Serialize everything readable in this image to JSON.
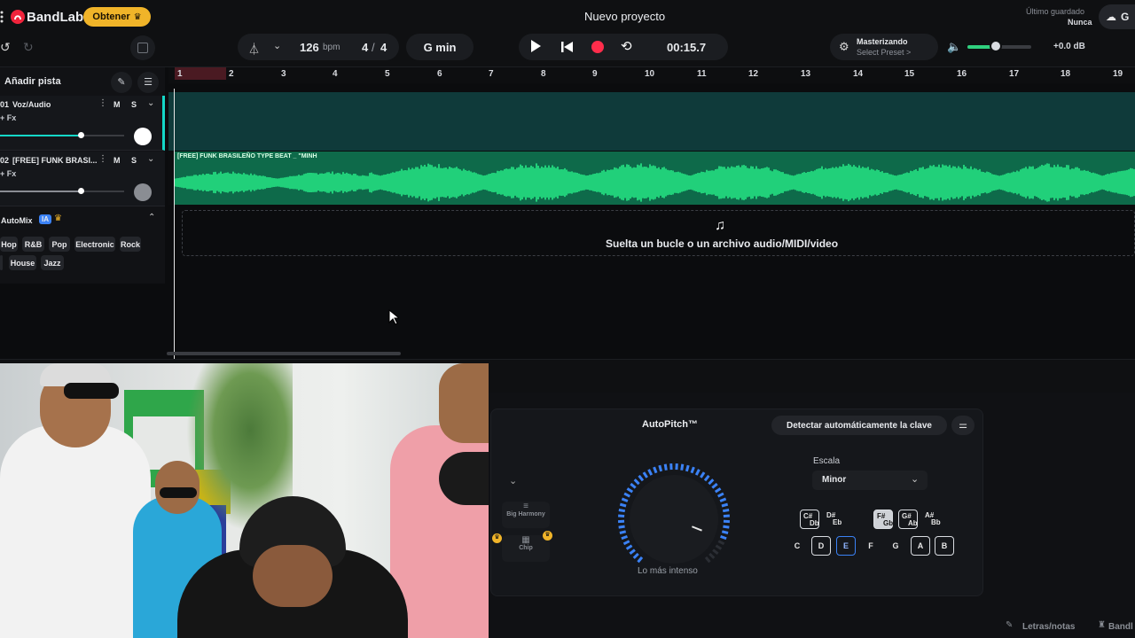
{
  "app": {
    "brand": "BandLab",
    "get_label": "Obtener",
    "project_title": "Nuevo proyecto",
    "last_saved_label": "Último guardado",
    "last_saved_value": "Nunca",
    "get_btn_partial": "G"
  },
  "transport": {
    "bpm_value": "126",
    "bpm_unit": "bpm",
    "time_sig_num": "4",
    "time_sig_sep": "/",
    "time_sig_den": "4",
    "key": "G min",
    "time": "00:15.7"
  },
  "mastering": {
    "title": "Masterizando",
    "preset": "Select Preset >"
  },
  "volume": {
    "db": "+0.0 dB",
    "level": 0.45
  },
  "left": {
    "add_track": "Añadir pista",
    "tracks": [
      {
        "num": "01",
        "name": "Voz/Audio",
        "fx": "+ Fx",
        "m": "M",
        "s": "S",
        "volume": 0.6
      },
      {
        "num": "02",
        "name": "[FREE] FUNK BRASI...",
        "fx": "+ Fx",
        "m": "M",
        "s": "S",
        "volume": 0.6
      }
    ],
    "automix": {
      "label": "AutoMix",
      "ia": "IA",
      "genres_row1": [
        "Hop",
        "R&B",
        "Pop",
        "Electronic",
        "Rock"
      ],
      "genres_row2": [
        "House",
        "Jazz"
      ]
    }
  },
  "ruler": [
    "1",
    "2",
    "3",
    "4",
    "5",
    "6",
    "7",
    "8",
    "9",
    "10",
    "11",
    "12",
    "13",
    "14",
    "15",
    "16",
    "17",
    "18",
    "19"
  ],
  "clip": {
    "name": "[FREE] FUNK BRASILEÑO TYPE BEAT _ \"MINH"
  },
  "drop": {
    "text": "Suelta un bucle o un archivo audio/MIDI/video"
  },
  "autopitch": {
    "title": "AutoPitch™",
    "detect": "Detectar automáticamente la clave",
    "intensity_label": "Lo más intenso",
    "intensity": 0.9,
    "scale_label": "Escala",
    "scale_value": "Minor",
    "effects": [
      "Big Harmony",
      "Chip"
    ],
    "sharps": [
      {
        "top": "C#",
        "bot": "Db"
      },
      {
        "top": "D#",
        "bot": "Eb"
      },
      {
        "top": "F#",
        "bot": "Gb"
      },
      {
        "top": "G#",
        "bot": "Ab"
      },
      {
        "top": "A#",
        "bot": "Bb"
      }
    ],
    "naturals": [
      "C",
      "D",
      "E",
      "F",
      "G",
      "A",
      "B"
    ]
  },
  "bottom": {
    "lyrics": "Letras/notas",
    "bandlab": "Bandl"
  },
  "colors": {
    "accent": "#f0b429",
    "record": "#ff2d4b",
    "wave": "#21d07a",
    "teal": "#14d8c8",
    "knob_blue": "#3b82f6"
  }
}
